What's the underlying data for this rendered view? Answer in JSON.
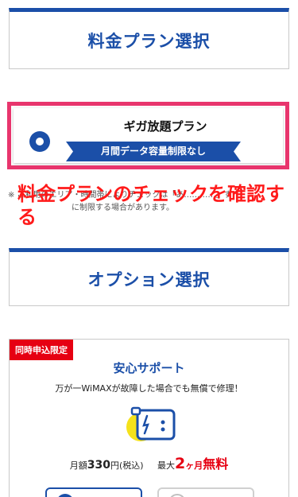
{
  "sections": {
    "plan_title": "料金プラン選択",
    "option_title": "オプション選択"
  },
  "plan": {
    "name": "ギガ放題プラン",
    "ribbon": "月間データ容量制限なし",
    "selected": true
  },
  "note": {
    "line1": "※ ご利用のエリア・時間帯によりチェックは「あ…………」す",
    "line2": "　　　　　　　　に制限する場合があります。"
  },
  "overlay": {
    "text": "料金プランのチェックを確認する"
  },
  "option": {
    "badge": "同時申込限定",
    "title": "安心サポート",
    "description": "万が一WiMAXが故障した場合でも無償で修理！",
    "price_prefix": "月額",
    "price_value": "330",
    "price_suffix": "円(税込)",
    "max_label": "最大",
    "free_months": "2",
    "free_unit": "ヶ月",
    "free_label": "無料"
  },
  "colors": {
    "accent": "#1b4fa8",
    "highlight": "#e8356d",
    "alert": "#e60012"
  },
  "icons": {
    "radio": "radio-selected-icon",
    "illustration": "repair-card-icon"
  }
}
